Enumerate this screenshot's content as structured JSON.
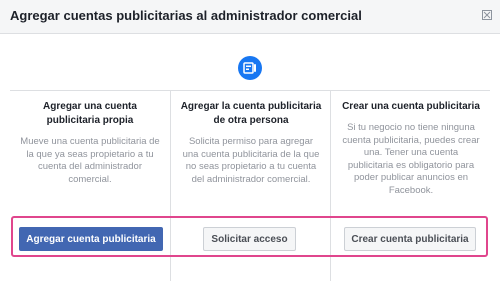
{
  "dialog": {
    "title": "Agregar cuentas publicitarias al administrador comercial",
    "close_icon": "close-icon",
    "center_icon": "ad-account-icon"
  },
  "options": [
    {
      "title": "Agregar una cuenta publicitaria propia",
      "description": "Mueve una cuenta publicitaria de la que ya seas propietario a tu cuenta del administrador comercial.",
      "button_label": "Agregar cuenta publicitaria"
    },
    {
      "title": "Agregar la cuenta publicitaria de otra persona",
      "description": "Solicita permiso para agregar una cuenta publicitaria de la que no seas propietario a tu cuenta del administrador comercial.",
      "button_label": "Solicitar acceso"
    },
    {
      "title": "Crear una cuenta publicitaria",
      "description": "Si tu negocio no tiene ninguna cuenta publicitaria, puedes crear una. Tener una cuenta publicitaria es obligatorio para poder publicar anuncios en Facebook.",
      "button_label": "Crear cuenta publicitaria"
    }
  ],
  "colors": {
    "primary": "#4267b2",
    "accent_icon": "#1877f2",
    "highlight": "#e0468d"
  }
}
